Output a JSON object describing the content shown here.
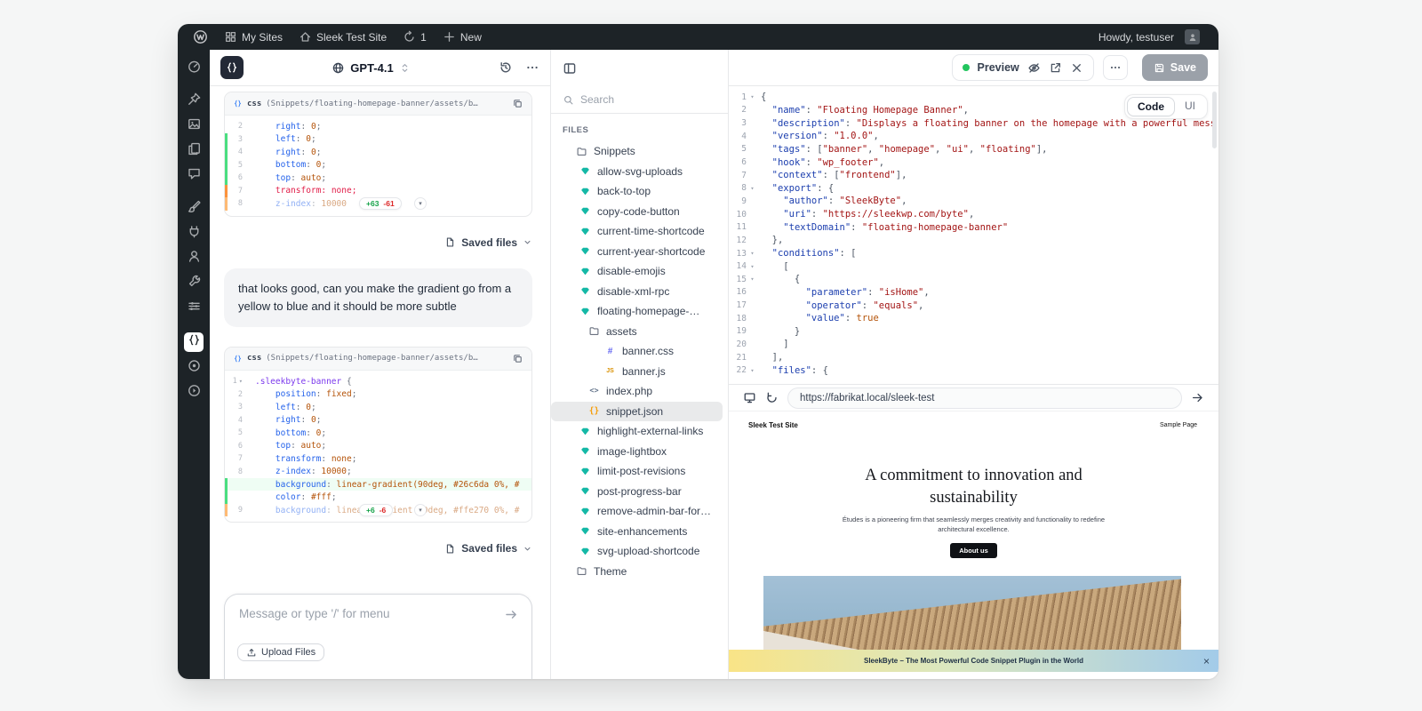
{
  "admin_bar": {
    "my_sites": "My Sites",
    "site_name": "Sleek Test Site",
    "updates": "1",
    "new_label": "New",
    "howdy": "Howdy, testuser"
  },
  "wp_sidebar": {
    "items": [
      {
        "icon": "dashboard",
        "label": "dashboard"
      },
      {
        "icon": "pin",
        "label": "posts"
      },
      {
        "icon": "media",
        "label": "media"
      },
      {
        "icon": "pages",
        "label": "pages"
      },
      {
        "icon": "comments",
        "label": "comments"
      },
      {
        "icon": "brush",
        "label": "appearance"
      },
      {
        "icon": "plug",
        "label": "plugins"
      },
      {
        "icon": "users",
        "label": "users"
      },
      {
        "icon": "tools",
        "label": "tools"
      },
      {
        "icon": "sliders",
        "label": "settings"
      },
      {
        "icon": "braces",
        "label": "sleekbyte-snippets",
        "active": true
      },
      {
        "icon": "target",
        "label": "target"
      },
      {
        "icon": "play",
        "label": "collapse-menu"
      }
    ]
  },
  "chat": {
    "model_label": "GPT-4.1",
    "saved_files_label": "Saved files",
    "user_message": "that looks good, can you make the gradient go from a yellow to blue and it should be more subtle",
    "input_placeholder": "Message or type '/' for menu",
    "upload_label": "Upload Files",
    "blocks": [
      {
        "lang": "css",
        "path": "(Snippets/floating-homepage-banner/assets/b…",
        "lines": [
          {
            "n": "2",
            "t": "    right: 0;"
          },
          {
            "n": "3",
            "t": "    left: 0;",
            "cls": "add"
          },
          {
            "n": "4",
            "t": "    right: 0;",
            "cls": "add"
          },
          {
            "n": "5",
            "t": "    bottom: 0;",
            "cls": "add"
          },
          {
            "n": "6",
            "t": "    top: auto;",
            "cls": "add"
          },
          {
            "n": "7",
            "t": "    transform: none;",
            "cls": "rem"
          },
          {
            "n": "8",
            "t": "    z-index: 10000",
            "cls": "fade",
            "badge": {
              "plus": "+63",
              "minus": "-61"
            }
          }
        ]
      },
      {
        "lang": "css",
        "path": "(Snippets/floating-homepage-banner/assets/b…",
        "lines": [
          {
            "n": "1",
            "t": ".sleekbyte-banner {",
            "fold": true
          },
          {
            "n": "2",
            "t": "    position: fixed;"
          },
          {
            "n": "3",
            "t": "    left: 0;"
          },
          {
            "n": "4",
            "t": "    right: 0;"
          },
          {
            "n": "5",
            "t": "    bottom: 0;"
          },
          {
            "n": "6",
            "t": "    top: auto;"
          },
          {
            "n": "7",
            "t": "    transform: none;"
          },
          {
            "n": "8",
            "t": "    z-index: 10000;"
          },
          {
            "n": "",
            "t": "    background: linear-gradient(90deg, #26c6da 0%, #",
            "cls": "addbg"
          },
          {
            "n": "",
            "t": "    color: #fff;",
            "cls": "add"
          },
          {
            "n": "9",
            "t": "    background: linear-gradient(90deg, #ffe270 0%, #",
            "cls": "fade",
            "badge": {
              "plus": "+6",
              "minus": "-6"
            }
          }
        ]
      }
    ]
  },
  "files_panel": {
    "search_placeholder": "Search",
    "section_label": "FILES",
    "tree": [
      {
        "type": "folder",
        "label": "Snippets",
        "depth": 0
      },
      {
        "type": "snippet",
        "label": "allow-svg-uploads",
        "depth": 1
      },
      {
        "type": "snippet",
        "label": "back-to-top",
        "depth": 1
      },
      {
        "type": "snippet",
        "label": "copy-code-button",
        "depth": 1
      },
      {
        "type": "snippet",
        "label": "current-time-shortcode",
        "depth": 1
      },
      {
        "type": "snippet",
        "label": "current-year-shortcode",
        "depth": 1
      },
      {
        "type": "snippet",
        "label": "disable-emojis",
        "depth": 1
      },
      {
        "type": "snippet",
        "label": "disable-xml-rpc",
        "depth": 1
      },
      {
        "type": "snippet",
        "label": "floating-homepage-…",
        "depth": 1
      },
      {
        "type": "folder",
        "label": "assets",
        "depth": 2
      },
      {
        "type": "css",
        "label": "banner.css",
        "depth": 3
      },
      {
        "type": "js",
        "label": "banner.js",
        "depth": 3
      },
      {
        "type": "php",
        "label": "index.php",
        "depth": 2
      },
      {
        "type": "json",
        "label": "snippet.json",
        "depth": 2,
        "selected": true
      },
      {
        "type": "snippet",
        "label": "highlight-external-links",
        "depth": 1
      },
      {
        "type": "snippet",
        "label": "image-lightbox",
        "depth": 1
      },
      {
        "type": "snippet",
        "label": "limit-post-revisions",
        "depth": 1
      },
      {
        "type": "snippet",
        "label": "post-progress-bar",
        "depth": 1
      },
      {
        "type": "snippet",
        "label": "remove-admin-bar-for…",
        "depth": 1
      },
      {
        "type": "snippet",
        "label": "site-enhancements",
        "depth": 1
      },
      {
        "type": "snippet",
        "label": "svg-upload-shortcode",
        "depth": 1
      },
      {
        "type": "folder",
        "label": "Theme",
        "depth": 0
      }
    ]
  },
  "editor": {
    "preview_label": "Preview",
    "save_label": "Save",
    "toggle": {
      "code": "Code",
      "ui": "UI"
    },
    "fold_lines": [
      1,
      8,
      13,
      14,
      15,
      22
    ],
    "code_lines": [
      "{",
      "  \"name\": \"Floating Homepage Banner\",",
      "  \"description\": \"Displays a floating banner on the homepage with a powerful mess",
      "  \"version\": \"1.0.0\",",
      "  \"tags\": [\"banner\", \"homepage\", \"ui\", \"floating\"],",
      "  \"hook\": \"wp_footer\",",
      "  \"context\": [\"frontend\"],",
      "  \"export\": {",
      "    \"author\": \"SleekByte\",",
      "    \"uri\": \"https://sleekwp.com/byte\",",
      "    \"textDomain\": \"floating-homepage-banner\"",
      "  },",
      "  \"conditions\": [",
      "    [",
      "      {",
      "        \"parameter\": \"isHome\",",
      "        \"operator\": \"equals\",",
      "        \"value\": true",
      "      }",
      "    ]",
      "  ],",
      "  \"files\": {"
    ]
  },
  "preview": {
    "url": "https://fabrikat.local/sleek-test",
    "site": {
      "title": "Sleek Test Site",
      "nav_link": "Sample Page",
      "heading": "A commitment to innovation and sustainability",
      "body": "Études is a pioneering firm that seamlessly merges creativity and functionality to redefine architectural excellence.",
      "cta": "About us",
      "banner_text": "SleekByte – The Most Powerful Code Snippet Plugin in the World"
    }
  }
}
